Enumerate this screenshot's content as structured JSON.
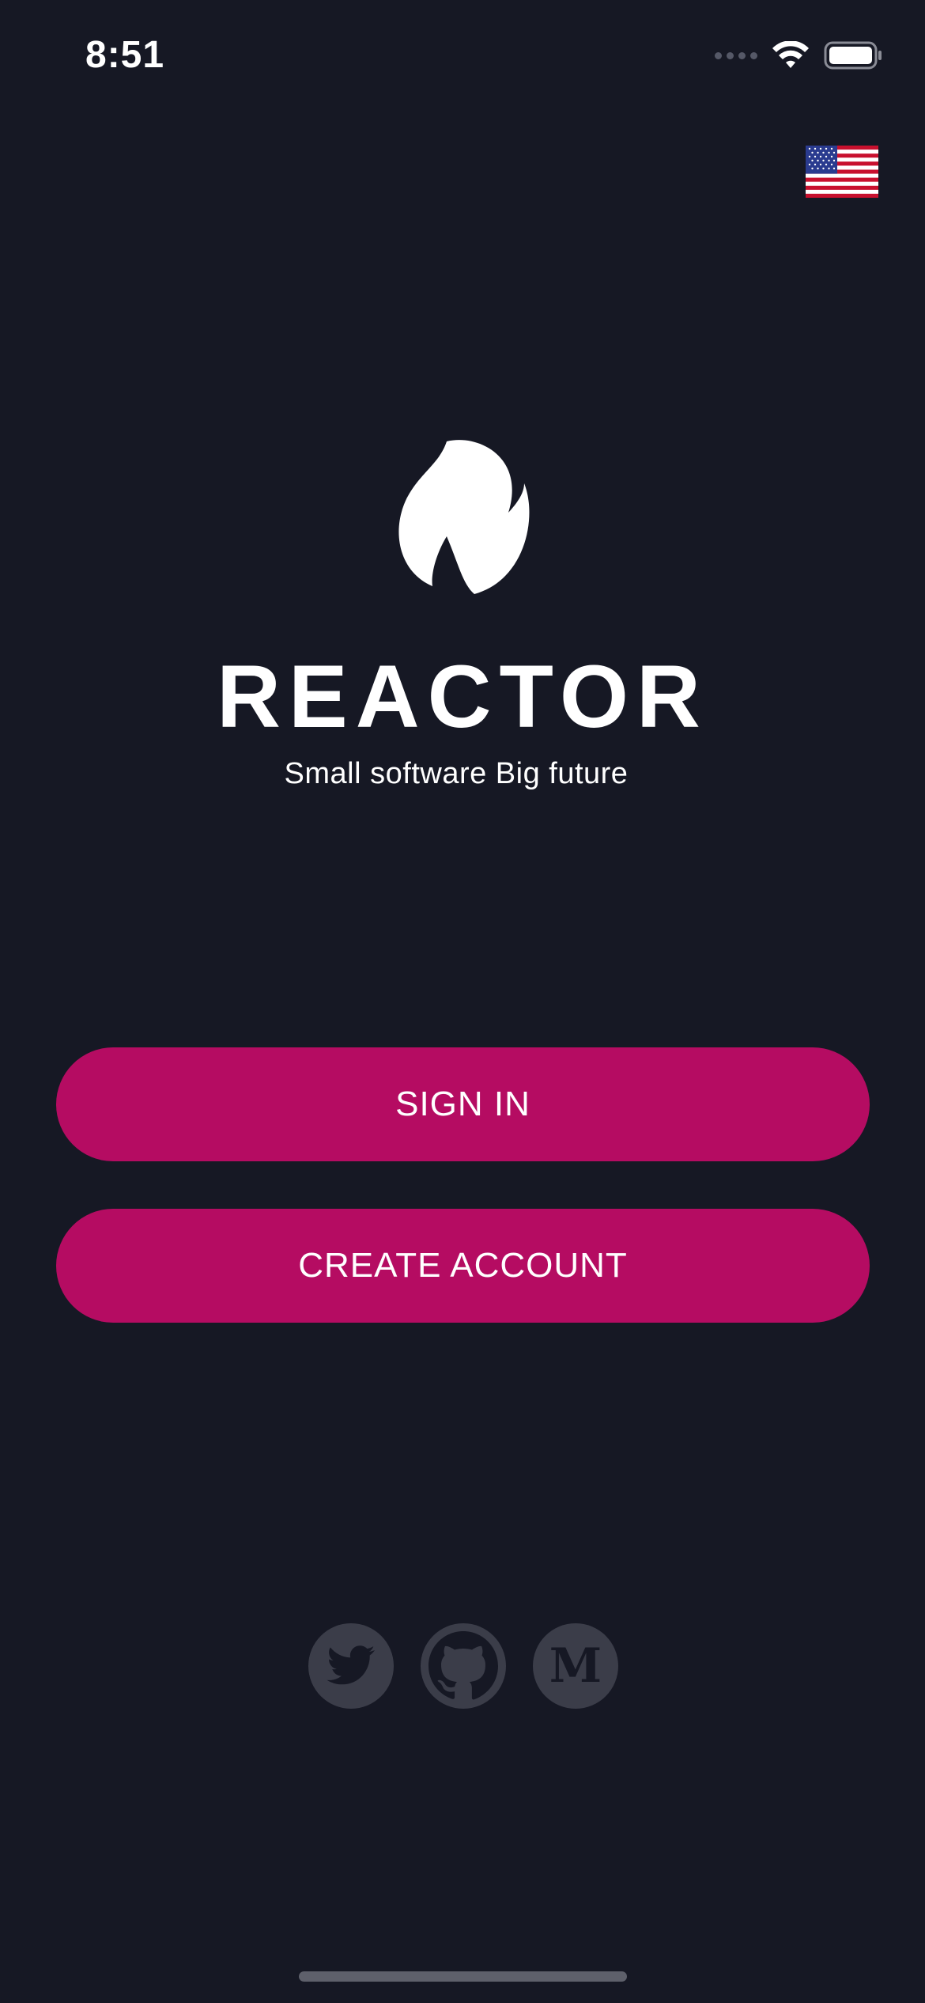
{
  "status_bar": {
    "time": "8:51"
  },
  "language": {
    "flag_icon": "us-flag-icon"
  },
  "brand": {
    "app_name": "REACTOR",
    "tagline": "Small software Big future",
    "logo_icon": "flame-icon"
  },
  "actions": {
    "sign_in_label": "SIGN IN",
    "create_account_label": "CREATE ACCOUNT"
  },
  "social": {
    "items": [
      "twitter-icon",
      "github-icon",
      "medium-icon"
    ],
    "medium_glyph": "M"
  },
  "colors": {
    "background": "#161824",
    "accent": "#b50c62",
    "social_circle": "#3b3d49"
  }
}
